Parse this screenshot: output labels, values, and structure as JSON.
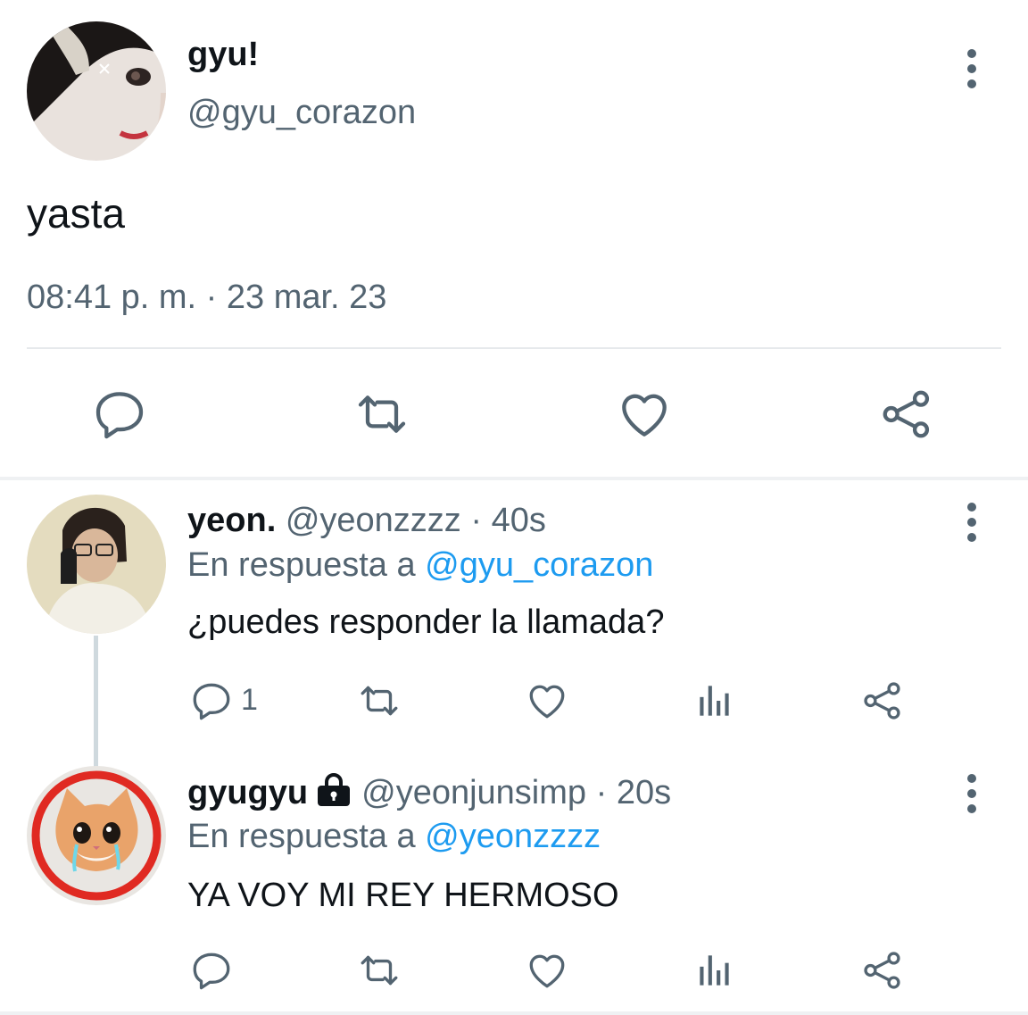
{
  "main_tweet": {
    "display_name": "gyu!",
    "handle": "@gyu_corazon",
    "text": "yasta",
    "timestamp": "08:41 p. m. · 23 mar. 23",
    "actions": [
      "reply-icon",
      "retweet-icon",
      "like-icon",
      "share-icon"
    ]
  },
  "replies": [
    {
      "display_name": "yeon.",
      "handle": "@yeonzzzz",
      "time": "· 40s",
      "in_reply_prefix": "En respuesta a",
      "in_reply_to": "@gyu_corazon",
      "text": "¿puedes responder la llamada?",
      "reply_count": "1",
      "actions": [
        "reply-icon",
        "retweet-icon",
        "like-icon",
        "analytics-icon",
        "share-icon"
      ]
    },
    {
      "display_name": "gyugyu",
      "protected": true,
      "handle": "@yeonjunsimp",
      "time": "· 20s",
      "in_reply_prefix": "En respuesta a",
      "in_reply_to": "@yeonzzzz",
      "text": "YA VOY MI REY HERMOSO",
      "reply_count": "",
      "actions": [
        "reply-icon",
        "retweet-icon",
        "like-icon",
        "analytics-icon",
        "share-icon"
      ]
    }
  ],
  "colors": {
    "text_primary": "#0f1419",
    "text_secondary": "#536471",
    "mention": "#1d9bf0",
    "icon": "#536471",
    "divider": "#e6e9ec"
  }
}
